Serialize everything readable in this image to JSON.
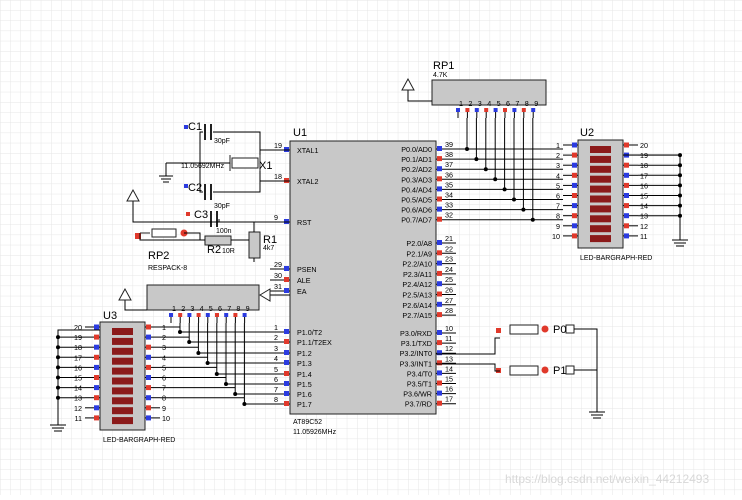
{
  "colors": {
    "background": "#ffffff",
    "grid": "#e6e6e6",
    "chip_body": "#c8c8c8",
    "wire": "#000000",
    "pin_red": "#e0392b",
    "pin_blue": "#2b3be0",
    "led_segment": "#8b1a1a"
  },
  "mcu": {
    "ref": "U1",
    "part": "AT89C52",
    "freq": "11.05926MHz",
    "left_pins": [
      {
        "num": "19",
        "name": "XTAL1"
      },
      {
        "num": "18",
        "name": "XTAL2"
      },
      {
        "num": "9",
        "name": "RST"
      },
      {
        "num": "29",
        "name": "PSEN"
      },
      {
        "num": "30",
        "name": "ALE"
      },
      {
        "num": "31",
        "name": "EA"
      },
      {
        "num": "1",
        "name": "P1.0/T2"
      },
      {
        "num": "2",
        "name": "P1.1/T2EX"
      },
      {
        "num": "3",
        "name": "P1.2"
      },
      {
        "num": "4",
        "name": "P1.3"
      },
      {
        "num": "5",
        "name": "P1.4"
      },
      {
        "num": "6",
        "name": "P1.5"
      },
      {
        "num": "7",
        "name": "P1.6"
      },
      {
        "num": "8",
        "name": "P1.7"
      }
    ],
    "right_pins": [
      {
        "num": "39",
        "name": "P0.0/AD0"
      },
      {
        "num": "38",
        "name": "P0.1/AD1"
      },
      {
        "num": "37",
        "name": "P0.2/AD2"
      },
      {
        "num": "36",
        "name": "P0.3/AD3"
      },
      {
        "num": "35",
        "name": "P0.4/AD4"
      },
      {
        "num": "34",
        "name": "P0.5/AD5"
      },
      {
        "num": "33",
        "name": "P0.6/AD6"
      },
      {
        "num": "32",
        "name": "P0.7/AD7"
      },
      {
        "num": "21",
        "name": "P2.0/A8"
      },
      {
        "num": "22",
        "name": "P2.1/A9"
      },
      {
        "num": "23",
        "name": "P2.2/A10"
      },
      {
        "num": "24",
        "name": "P2.3/A11"
      },
      {
        "num": "25",
        "name": "P2.4/A12"
      },
      {
        "num": "26",
        "name": "P2.5/A13"
      },
      {
        "num": "27",
        "name": "P2.6/A14"
      },
      {
        "num": "28",
        "name": "P2.7/A15"
      },
      {
        "num": "10",
        "name": "P3.0/RXD"
      },
      {
        "num": "11",
        "name": "P3.1/TXD"
      },
      {
        "num": "12",
        "name": "P3.2/INT0"
      },
      {
        "num": "13",
        "name": "P3.3/INT1"
      },
      {
        "num": "14",
        "name": "P3.4/T0"
      },
      {
        "num": "15",
        "name": "P3.5/T1"
      },
      {
        "num": "16",
        "name": "P3.6/WR"
      },
      {
        "num": "17",
        "name": "P3.7/RD"
      }
    ]
  },
  "bargraph_u2": {
    "ref": "U2",
    "part": "LED-BARGRAPH-RED",
    "left_nums": [
      "1",
      "2",
      "3",
      "4",
      "5",
      "6",
      "7",
      "8",
      "9",
      "10"
    ],
    "right_nums": [
      "20",
      "19",
      "18",
      "17",
      "16",
      "15",
      "14",
      "13",
      "12",
      "11"
    ]
  },
  "bargraph_u3": {
    "ref": "U3",
    "part": "LED-BARGRAPH-RED",
    "left_nums": [
      "20",
      "19",
      "18",
      "17",
      "16",
      "15",
      "14",
      "13",
      "12",
      "11"
    ],
    "right_nums": [
      "1",
      "2",
      "3",
      "4",
      "5",
      "6",
      "7",
      "8",
      "9",
      "10"
    ]
  },
  "rp1": {
    "ref": "RP1",
    "value": "4.7K",
    "pins": [
      "1",
      "2",
      "3",
      "4",
      "5",
      "6",
      "7",
      "8",
      "9"
    ]
  },
  "rp2": {
    "ref": "RP2",
    "value": "RESPACK-8",
    "pins": [
      "1",
      "2",
      "3",
      "4",
      "5",
      "6",
      "7",
      "8",
      "9"
    ]
  },
  "x1": {
    "ref": "X1",
    "value": "11.05692MHz"
  },
  "c1": {
    "ref": "C1",
    "value": "30pF"
  },
  "c2": {
    "ref": "C2",
    "value": "30pF"
  },
  "c3": {
    "ref": "C3",
    "value": "100n"
  },
  "r1": {
    "ref": "R1",
    "value": "4k7"
  },
  "r2": {
    "ref": "R2",
    "value": "10R"
  },
  "p0": {
    "ref": "P0"
  },
  "p1": {
    "ref": "P1"
  },
  "watermark": "https://blog.csdn.net/weixin_44212493"
}
